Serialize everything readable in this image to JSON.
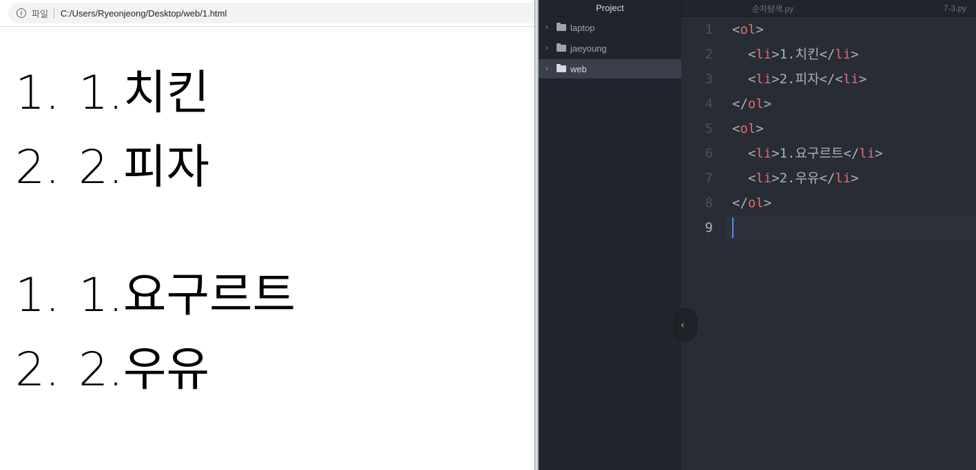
{
  "browser": {
    "scheme_label": "파일",
    "url": "C:/Users/Ryeonjeong/Desktop/web/1.html",
    "lists": [
      {
        "items": [
          {
            "marker": "1.",
            "text": "1.치킨"
          },
          {
            "marker": "2.",
            "text": "2.피자"
          }
        ]
      },
      {
        "items": [
          {
            "marker": "1.",
            "text": "1.요구르트"
          },
          {
            "marker": "2.",
            "text": "2.우유"
          }
        ]
      }
    ]
  },
  "editor": {
    "tree_title": "Project",
    "tree_items": [
      {
        "label": "laptop",
        "selected": false
      },
      {
        "label": "jaeyoung",
        "selected": false
      },
      {
        "label": "web",
        "selected": true
      }
    ],
    "tabs": [
      {
        "label": "순차탐색.py"
      },
      {
        "label": "7-3.py"
      }
    ],
    "line_numbers": [
      "1",
      "2",
      "3",
      "4",
      "5",
      "6",
      "7",
      "8",
      "9"
    ],
    "current_line": "9",
    "lines": [
      [
        {
          "t": "punct",
          "v": "<"
        },
        {
          "t": "tag",
          "v": "ol"
        },
        {
          "t": "punct",
          "v": ">"
        }
      ],
      [
        {
          "t": "punct",
          "v": "  <"
        },
        {
          "t": "tag",
          "v": "li"
        },
        {
          "t": "punct",
          "v": ">"
        },
        {
          "t": "text",
          "v": "1.치킨"
        },
        {
          "t": "punct",
          "v": "</"
        },
        {
          "t": "tag",
          "v": "li"
        },
        {
          "t": "punct",
          "v": ">"
        }
      ],
      [
        {
          "t": "punct",
          "v": "  <"
        },
        {
          "t": "tag",
          "v": "li"
        },
        {
          "t": "punct",
          "v": ">"
        },
        {
          "t": "text",
          "v": "2.피자"
        },
        {
          "t": "punct",
          "v": "</<"
        },
        {
          "t": "tag",
          "v": "li"
        },
        {
          "t": "punct",
          "v": ">"
        }
      ],
      [
        {
          "t": "punct",
          "v": "</"
        },
        {
          "t": "tag",
          "v": "ol"
        },
        {
          "t": "punct",
          "v": ">"
        }
      ],
      [
        {
          "t": "punct",
          "v": "<"
        },
        {
          "t": "tag",
          "v": "ol"
        },
        {
          "t": "punct",
          "v": ">"
        }
      ],
      [
        {
          "t": "punct",
          "v": "  <"
        },
        {
          "t": "tag",
          "v": "li"
        },
        {
          "t": "punct",
          "v": ">"
        },
        {
          "t": "text",
          "v": "1.요구르트"
        },
        {
          "t": "punct",
          "v": "</"
        },
        {
          "t": "tag",
          "v": "li"
        },
        {
          "t": "punct",
          "v": ">"
        }
      ],
      [
        {
          "t": "punct",
          "v": "  <"
        },
        {
          "t": "tag",
          "v": "li"
        },
        {
          "t": "punct",
          "v": ">"
        },
        {
          "t": "text",
          "v": "2.우유"
        },
        {
          "t": "punct",
          "v": "</"
        },
        {
          "t": "tag",
          "v": "li"
        },
        {
          "t": "punct",
          "v": ">"
        }
      ],
      [
        {
          "t": "punct",
          "v": "</"
        },
        {
          "t": "tag",
          "v": "ol"
        },
        {
          "t": "punct",
          "v": ">"
        }
      ],
      []
    ]
  },
  "icons": {
    "address_info": "info-icon",
    "tree_chevron": "chevron-right-icon",
    "tree_folder": "folder-icon",
    "tree_toggle": "chevron-left-icon"
  },
  "colors": {
    "editor_bg": "#282c34",
    "tree_bg": "#21252b",
    "tag": "#e06c75",
    "text": "#abb2bf",
    "caret": "#528bff"
  }
}
